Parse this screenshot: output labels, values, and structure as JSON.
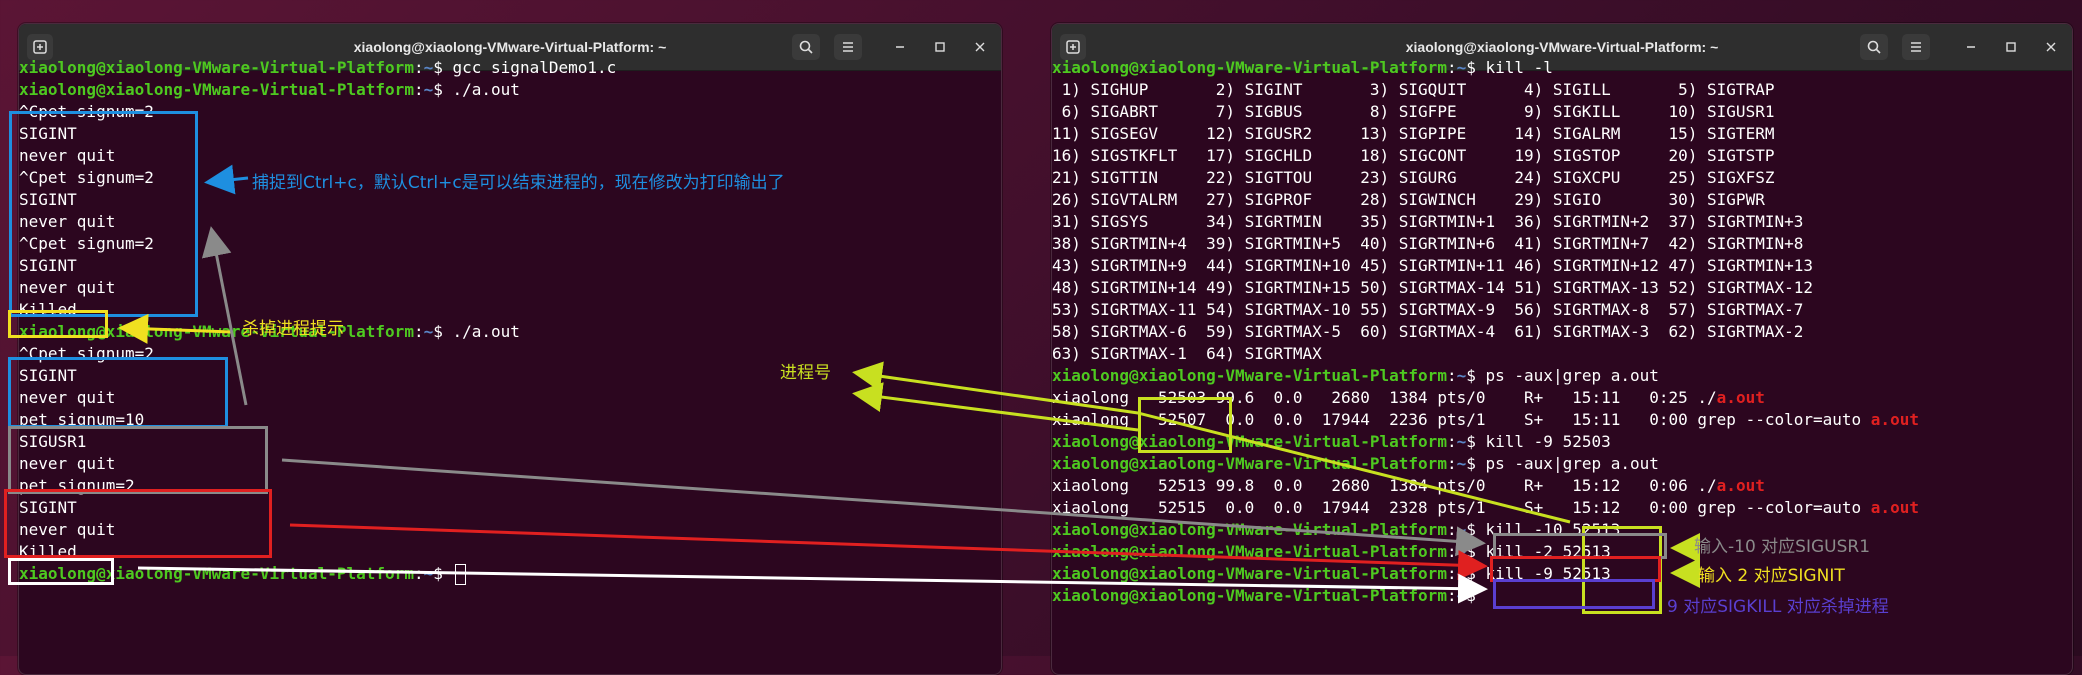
{
  "left_window": {
    "title": "xiaolong@xiaolong-VMware-Virtual-Platform: ~",
    "lines": [
      {
        "user": "xiaolong@xiaolong-VMware-Virtual-Platform",
        "path": "~",
        "cmd": " gcc signalDemo1.c"
      },
      {
        "user": "xiaolong@xiaolong-VMware-Virtual-Platform",
        "path": "~",
        "cmd": " ./a.out"
      },
      {
        "text": "^Cpet signum=2"
      },
      {
        "text": "SIGINT"
      },
      {
        "text": "never quit"
      },
      {
        "text": "^Cpet signum=2"
      },
      {
        "text": "SIGINT"
      },
      {
        "text": "never quit"
      },
      {
        "text": "^Cpet signum=2"
      },
      {
        "text": "SIGINT"
      },
      {
        "text": "never quit"
      },
      {
        "text": "Killed"
      },
      {
        "user": "xiaolong@xiaolong-VMware-Virtual-Platform",
        "path": "~",
        "cmd": " ./a.out"
      },
      {
        "text": "^Cpet signum=2"
      },
      {
        "text": "SIGINT"
      },
      {
        "text": "never quit"
      },
      {
        "text": "pet signum=10"
      },
      {
        "text": "SIGUSR1"
      },
      {
        "text": "never quit"
      },
      {
        "text": "pet signum=2"
      },
      {
        "text": "SIGINT"
      },
      {
        "text": "never quit"
      },
      {
        "text": "Killed"
      },
      {
        "user": "xiaolong@xiaolong-VMware-Virtual-Platform",
        "path": "~",
        "cmd": " ",
        "cursor": true
      }
    ]
  },
  "right_window": {
    "title": "xiaolong@xiaolong-VMware-Virtual-Platform: ~",
    "lines": [
      {
        "user": "xiaolong@xiaolong-VMware-Virtual-Platform",
        "path": "~",
        "cmd": " kill -l"
      },
      {
        "text": " 1) SIGHUP       2) SIGINT       3) SIGQUIT      4) SIGILL       5) SIGTRAP"
      },
      {
        "text": " 6) SIGABRT      7) SIGBUS       8) SIGFPE       9) SIGKILL     10) SIGUSR1"
      },
      {
        "text": "11) SIGSEGV     12) SIGUSR2     13) SIGPIPE     14) SIGALRM     15) SIGTERM"
      },
      {
        "text": "16) SIGSTKFLT   17) SIGCHLD     18) SIGCONT     19) SIGSTOP     20) SIGTSTP"
      },
      {
        "text": "21) SIGTTIN     22) SIGTTOU     23) SIGURG      24) SIGXCPU     25) SIGXFSZ"
      },
      {
        "text": "26) SIGVTALRM   27) SIGPROF     28) SIGWINCH    29) SIGIO       30) SIGPWR"
      },
      {
        "text": "31) SIGSYS      34) SIGRTMIN    35) SIGRTMIN+1  36) SIGRTMIN+2  37) SIGRTMIN+3"
      },
      {
        "text": "38) SIGRTMIN+4  39) SIGRTMIN+5  40) SIGRTMIN+6  41) SIGRTMIN+7  42) SIGRTMIN+8"
      },
      {
        "text": "43) SIGRTMIN+9  44) SIGRTMIN+10 45) SIGRTMIN+11 46) SIGRTMIN+12 47) SIGRTMIN+13"
      },
      {
        "text": "48) SIGRTMIN+14 49) SIGRTMIN+15 50) SIGRTMAX-14 51) SIGRTMAX-13 52) SIGRTMAX-12"
      },
      {
        "text": "53) SIGRTMAX-11 54) SIGRTMAX-10 55) SIGRTMAX-9  56) SIGRTMAX-8  57) SIGRTMAX-7"
      },
      {
        "text": "58) SIGRTMAX-6  59) SIGRTMAX-5  60) SIGRTMAX-4  61) SIGRTMAX-3  62) SIGRTMAX-2"
      },
      {
        "text": "63) SIGRTMAX-1  64) SIGRTMAX"
      },
      {
        "user": "xiaolong@xiaolong-VMware-Virtual-Platform",
        "path": "~",
        "cmd": " ps -aux|grep a.out"
      },
      {
        "text": "xiaolong   52503 99.6  0.0   2680  1384 pts/0    R+   15:11   0:25 ./",
        "red": "a.out"
      },
      {
        "text": "xiaolong   52507  0.0  0.0  17944  2236 pts/1    S+   15:11   0:00 grep --color=auto ",
        "red": "a.out"
      },
      {
        "user": "xiaolong@xiaolong-VMware-Virtual-Platform",
        "path": "~",
        "cmd": " kill -9 52503"
      },
      {
        "user": "xiaolong@xiaolong-VMware-Virtual-Platform",
        "path": "~",
        "cmd": " ps -aux|grep a.out"
      },
      {
        "text": "xiaolong   52513 99.8  0.0   2680  1384 pts/0    R+   15:12   0:06 ./",
        "red": "a.out"
      },
      {
        "text": "xiaolong   52515  0.0  0.0  17944  2328 pts/1    S+   15:12   0:00 grep --color=auto ",
        "red": "a.out"
      },
      {
        "user": "xiaolong@xiaolong-VMware-Virtual-Platform",
        "path": "~",
        "cmd": " kill -10 52513"
      },
      {
        "user": "xiaolong@xiaolong-VMware-Virtual-Platform",
        "path": "~",
        "cmd": " kill -2 52513"
      },
      {
        "user": "xiaolong@xiaolong-VMware-Virtual-Platform",
        "path": "~",
        "cmd": " kill -9 52513"
      },
      {
        "user": "xiaolong@xiaolong-VMware-Virtual-Platform",
        "path": "~",
        "cmd": " "
      }
    ]
  },
  "annotations": {
    "capture_ctrl_c": "捕捉到Ctrl+c，默认Ctrl+c是可以结束进程的，现在修改为打印输出了",
    "kill_hint": "杀掉进程提示",
    "pid_label": "进程号",
    "sigusr1_note": "输入-10 对应SIGUSR1",
    "signit_note": "输入 2 对应SIGNIT",
    "sigkill_note": "9 对应SIGKILL  对应杀掉进程"
  },
  "colors": {
    "terminal_bg": "#2c061f",
    "prompt_user": "#4ec920",
    "prompt_path": "#5a86c7",
    "blue": "#1e8fe0",
    "yellow": "#f0e020",
    "gray": "#8a8a8a",
    "red": "#e02020",
    "white": "#ffffff",
    "yellow_green": "#c8e020",
    "purple": "#5a3fd0"
  }
}
